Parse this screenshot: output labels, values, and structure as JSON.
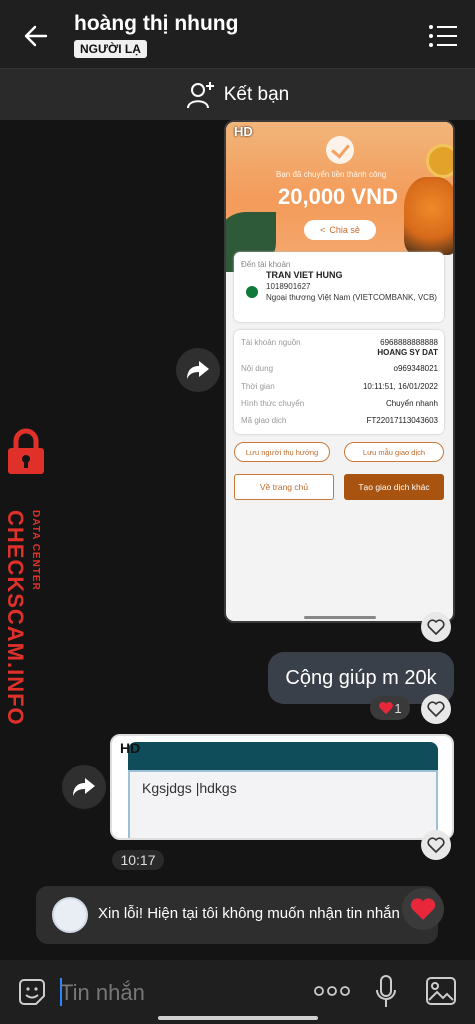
{
  "header": {
    "title": "hoàng thị nhung",
    "badge": "NGƯỜI LẠ",
    "back_icon": "arrow-left-icon",
    "menu_icon": "list-menu-icon"
  },
  "friend_bar": {
    "label": "Kết bạn",
    "icon": "add-person-icon"
  },
  "image_message": {
    "hd": "HD",
    "success_text": "Bạn đã chuyển tiền thành công",
    "amount": "20,000 VND",
    "share_label": "Chia sẻ",
    "dest_label": "Đến tài khoản",
    "dest_name": "TRAN VIET HUNG",
    "dest_account": "1018901627",
    "dest_bank": "Ngoại thương Việt Nam (VIETCOMBANK, VCB)",
    "rows": [
      {
        "label": "Tài khoản nguồn",
        "value": "6968888888888"
      },
      {
        "label": "",
        "value": "HOANG SY DAT"
      },
      {
        "label": "Nội dung",
        "value": "o969348021"
      },
      {
        "label": "Thời gian",
        "value": "10:11:51, 16/01/2022"
      },
      {
        "label": "Hình thức chuyển",
        "value": "Chuyển nhanh"
      },
      {
        "label": "Mã giao dịch",
        "value": "FT22017113043603"
      }
    ],
    "save_recipient": "Lưu người thụ hưởng",
    "save_template": "Lưu mẫu giao dịch",
    "home_button": "Về trang chủ",
    "new_transaction": "Tạo giao dịch khác"
  },
  "text_message": {
    "text": "Cộng giúp m 20k",
    "reaction_count": "1"
  },
  "note_message": {
    "hd": "HD",
    "text": "Kgsjdgs |hdkgs"
  },
  "timestamp": "10:17",
  "system_message": {
    "text": "Xin lỗi! Hiện tại tôi không muốn nhận tin nhắn"
  },
  "watermark": {
    "main": "CHECKSCAM.INFO",
    "sub": "DATA CENTER"
  },
  "input": {
    "placeholder": "Tin nhắn"
  },
  "colors": {
    "accent_orange": "#c86a2a",
    "watermark_red": "#e0302a",
    "bubble_bg": "#3a4049"
  }
}
